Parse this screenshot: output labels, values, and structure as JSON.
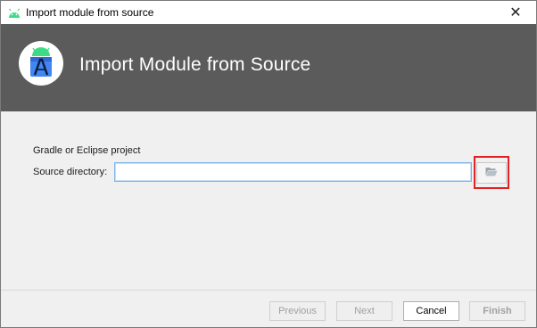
{
  "window": {
    "title": "Import module from source",
    "close_glyph": "✕"
  },
  "banner": {
    "title": "Import Module from Source",
    "logo_icon": "android-studio-icon"
  },
  "form": {
    "section_label": "Gradle or Eclipse project",
    "source_label": "Source directory:",
    "source_value": "",
    "browse_icon": "folder-open-icon"
  },
  "footer": {
    "previous_label": "Previous",
    "next_label": "Next",
    "cancel_label": "Cancel",
    "finish_label": "Finish"
  },
  "colors": {
    "banner_bg": "#5b5b5b",
    "highlight": "#e02222",
    "input_border": "#7eb4ea"
  }
}
